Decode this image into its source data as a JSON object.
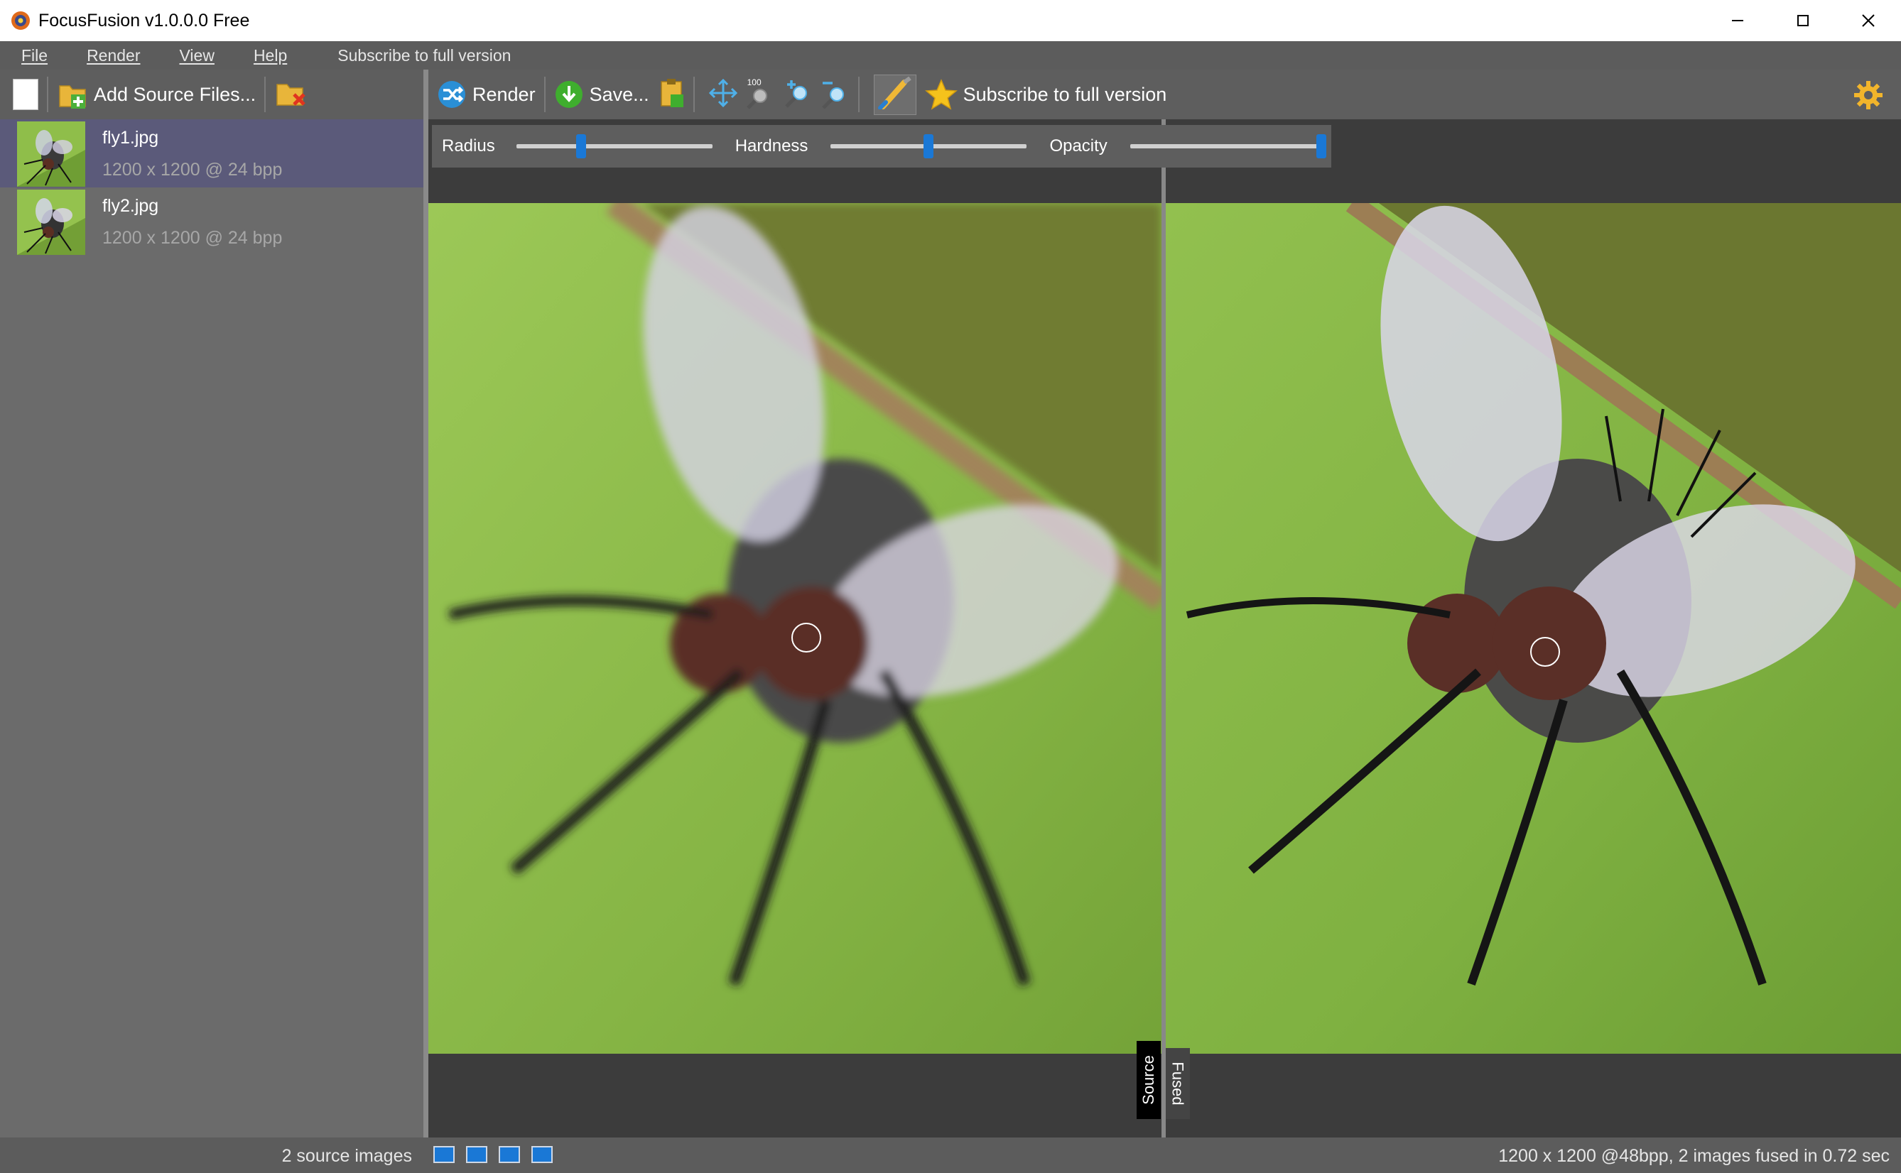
{
  "window": {
    "title": "FocusFusion v1.0.0.0 Free",
    "controls": [
      "minimize",
      "maximize",
      "close"
    ]
  },
  "menu": {
    "items": [
      "File",
      "Render",
      "View",
      "Help"
    ],
    "subscribe": "Subscribe to full version"
  },
  "left_toolbar": {
    "add_source": "Add Source Files..."
  },
  "files": [
    {
      "name": "fly1.jpg",
      "meta": "1200 x 1200 @ 24 bpp",
      "selected": true
    },
    {
      "name": "fly2.jpg",
      "meta": "1200 x 1200 @ 24 bpp",
      "selected": false
    }
  ],
  "right_toolbar": {
    "render": "Render",
    "save": "Save...",
    "zoom_100": "100",
    "subscribe": "Subscribe to full version"
  },
  "brush": {
    "radius_label": "Radius",
    "hardness_label": "Hardness",
    "opacity_label": "Opacity",
    "radius_value": 0.32,
    "hardness_value": 0.5,
    "opacity_value": 1.0
  },
  "views": {
    "source_tab": "Source",
    "fused_tab": "Fused"
  },
  "status": {
    "left": "2 source images",
    "right": "1200 x 1200 @48bpp, 2 images fused in 0.72 sec"
  },
  "colors": {
    "accent": "#1a78d6",
    "selected_row": "#5b5a7a",
    "leaf_green": "#8fbe4a"
  }
}
